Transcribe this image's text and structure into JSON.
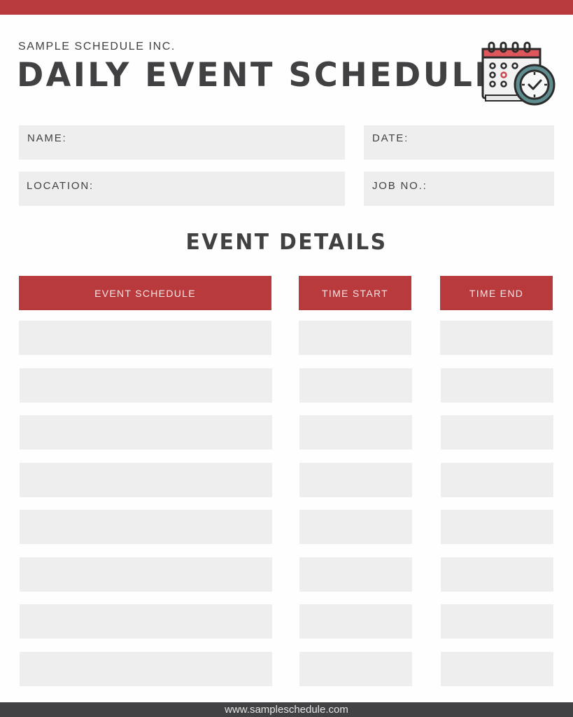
{
  "header": {
    "company": "SAMPLE SCHEDULE INC.",
    "title": "DAILY EVENT SCHEDULE",
    "icon": "calendar-clock-icon"
  },
  "fields": {
    "name_label": "NAME:",
    "date_label": "DATE:",
    "location_label": "LOCATION:",
    "job_no_label": "JOB NO.:"
  },
  "section": {
    "title": "EVENT DETAILS"
  },
  "table": {
    "columns": [
      "EVENT SCHEDULE",
      "TIME START",
      "TIME END"
    ],
    "rows": [
      [
        "",
        "",
        ""
      ],
      [
        "",
        "",
        ""
      ],
      [
        "",
        "",
        ""
      ],
      [
        "",
        "",
        ""
      ],
      [
        "",
        "",
        ""
      ],
      [
        "",
        "",
        ""
      ],
      [
        "",
        "",
        ""
      ],
      [
        "",
        "",
        ""
      ]
    ]
  },
  "footer": {
    "url": "www.sampleschedule.com"
  },
  "colors": {
    "accent": "#b83a3d",
    "text": "#414042",
    "field_bg": "#efeeef",
    "footer_bg": "#424143"
  }
}
